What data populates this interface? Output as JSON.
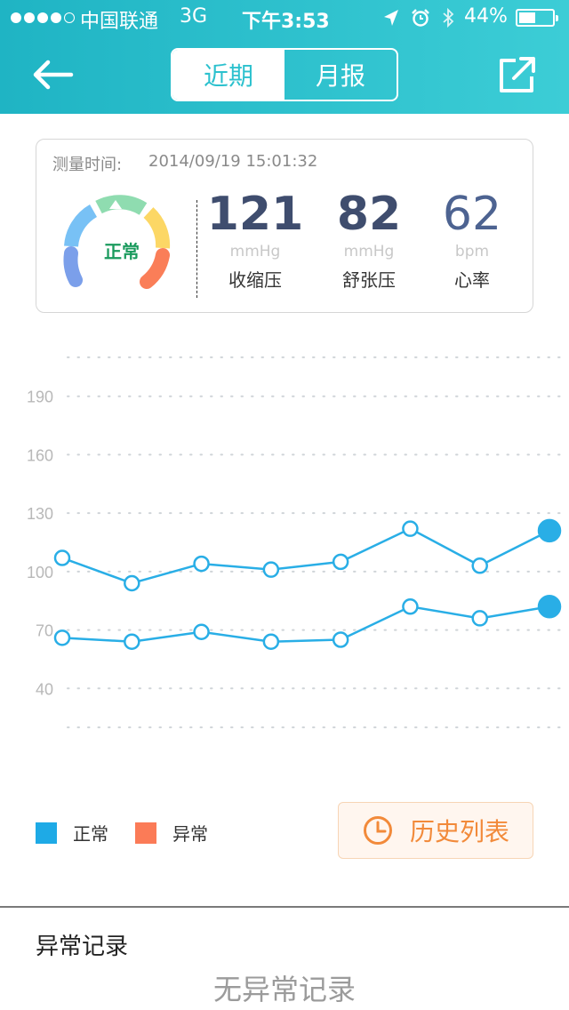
{
  "status_bar": {
    "carrier": "中国联通",
    "network": "3G",
    "time": "下午3:53",
    "battery": "44%",
    "battery_level": 0.44,
    "icons": [
      "location-arrow-icon",
      "alarm-icon",
      "bluetooth-icon",
      "battery-icon"
    ]
  },
  "header": {
    "tabs": [
      {
        "label": "近期",
        "active": true
      },
      {
        "label": "月报",
        "active": false
      }
    ],
    "back_icon": "back-arrow-icon",
    "share_icon": "share-icon",
    "accent": "#2cc1ce"
  },
  "measurement": {
    "time_label": "测量时间:",
    "time_value": "2014/09/19 15:01:32",
    "status": "正常",
    "systolic": {
      "value": "121",
      "unit": "mmHg",
      "label": "收缩压"
    },
    "diastolic": {
      "value": "82",
      "unit": "mmHg",
      "label": "舒张压"
    },
    "heart_rate": {
      "value": "62",
      "unit": "bpm",
      "label": "心率"
    }
  },
  "chart_data": {
    "type": "line",
    "x": [
      1,
      2,
      3,
      4,
      5,
      6,
      7,
      8
    ],
    "series": [
      {
        "values": [
          107,
          94,
          104,
          101,
          105,
          122,
          103,
          121
        ]
      },
      {
        "values": [
          66,
          64,
          69,
          64,
          65,
          82,
          76,
          82
        ]
      }
    ],
    "yticks": [
      40,
      70,
      100,
      130,
      160,
      190
    ],
    "ylim": [
      10,
      220
    ],
    "grid": true,
    "line_color": "#29aee6"
  },
  "legend": [
    {
      "label": "正常",
      "color": "#1eaae6"
    },
    {
      "label": "异常",
      "color": "#fb7b57"
    }
  ],
  "history_button": {
    "label": "历史列表",
    "icon": "clock-icon",
    "color": "#f28a3a"
  },
  "abnormal": {
    "title": "异常记录",
    "empty": "无异常记录"
  }
}
